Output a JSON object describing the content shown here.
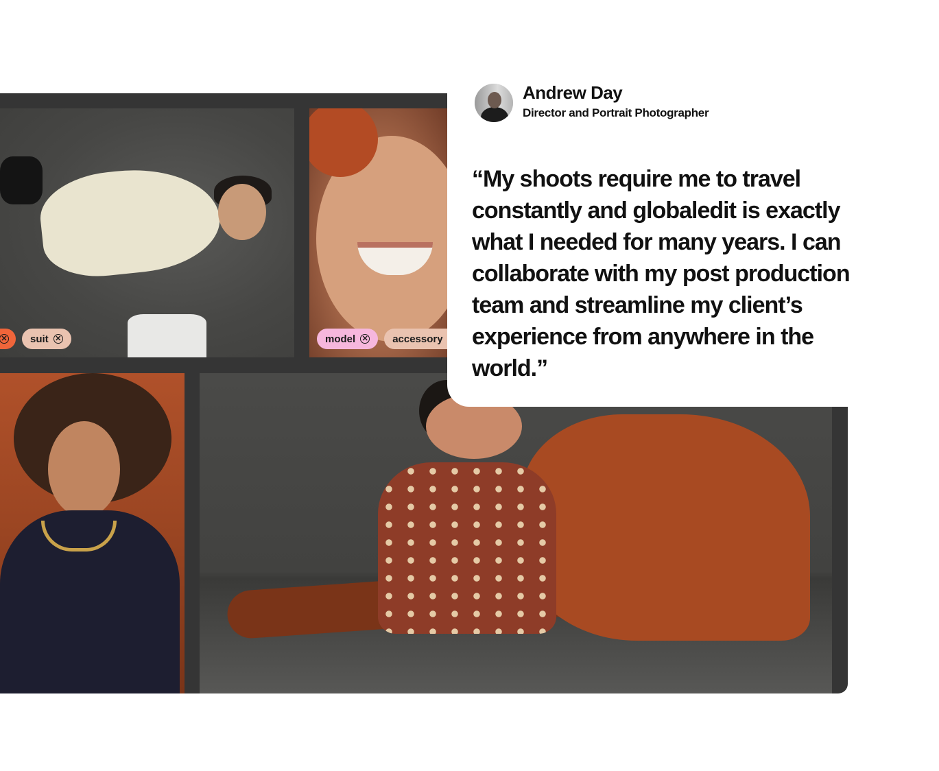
{
  "testimonial": {
    "name": "Andrew Day",
    "role": "Director and Portrait Photographer",
    "quote": "“My shoots require me to travel constantly and globaledit is exactly what I needed for many years. I can collaborate with my post production team and streamline my client’s experience from anywhere in the world.”",
    "avatar_icon": "person-avatar"
  },
  "photos": [
    {
      "subject": "model in cream suit",
      "tags": [
        {
          "label": "",
          "color": "#f0653a",
          "remove_icon": "close-circle-icon"
        },
        {
          "label": "suit",
          "color": "#eac3b0",
          "remove_icon": "close-circle-icon"
        }
      ]
    },
    {
      "subject": "smiling model close-up",
      "tags": [
        {
          "label": "model",
          "color": "#f6b7dd",
          "remove_icon": "close-circle-icon"
        },
        {
          "label": "accessory",
          "color": "#eac3b0",
          "remove_icon": "close-circle-icon"
        }
      ]
    },
    {
      "subject": "model with jewelry",
      "tags": []
    },
    {
      "subject": "model seated on floor",
      "tags": []
    }
  ],
  "colors": {
    "board_bg": "#353535",
    "tag_orange": "#f0653a",
    "tag_peach": "#eac3b0",
    "tag_pink": "#f6b7dd",
    "text": "#111111"
  }
}
